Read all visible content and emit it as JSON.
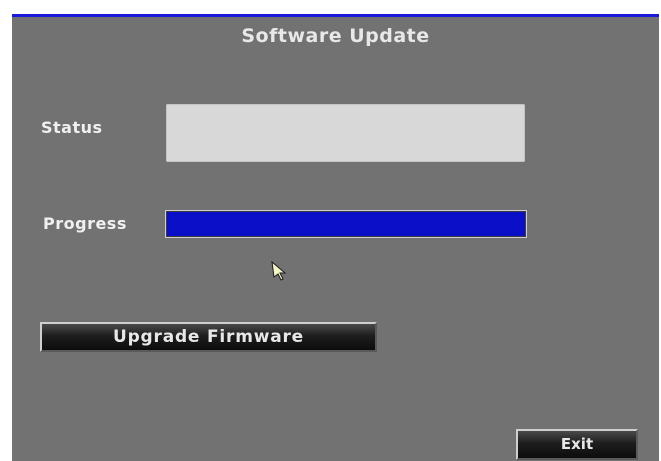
{
  "window": {
    "title": "Software Update"
  },
  "fields": {
    "status_label": "Status",
    "status_value": "",
    "progress_label": "Progress",
    "progress_fraction": 1.0
  },
  "buttons": {
    "upgrade_label": "Upgrade Firmware",
    "exit_label": "Exit"
  },
  "colors": {
    "panel_background": "#727272",
    "accent_border": "#1a1ad8",
    "progress_fill": "#0b10c8",
    "status_box": "#d8d8d8"
  },
  "icons": {
    "pointer": "mouse-pointer-icon"
  }
}
